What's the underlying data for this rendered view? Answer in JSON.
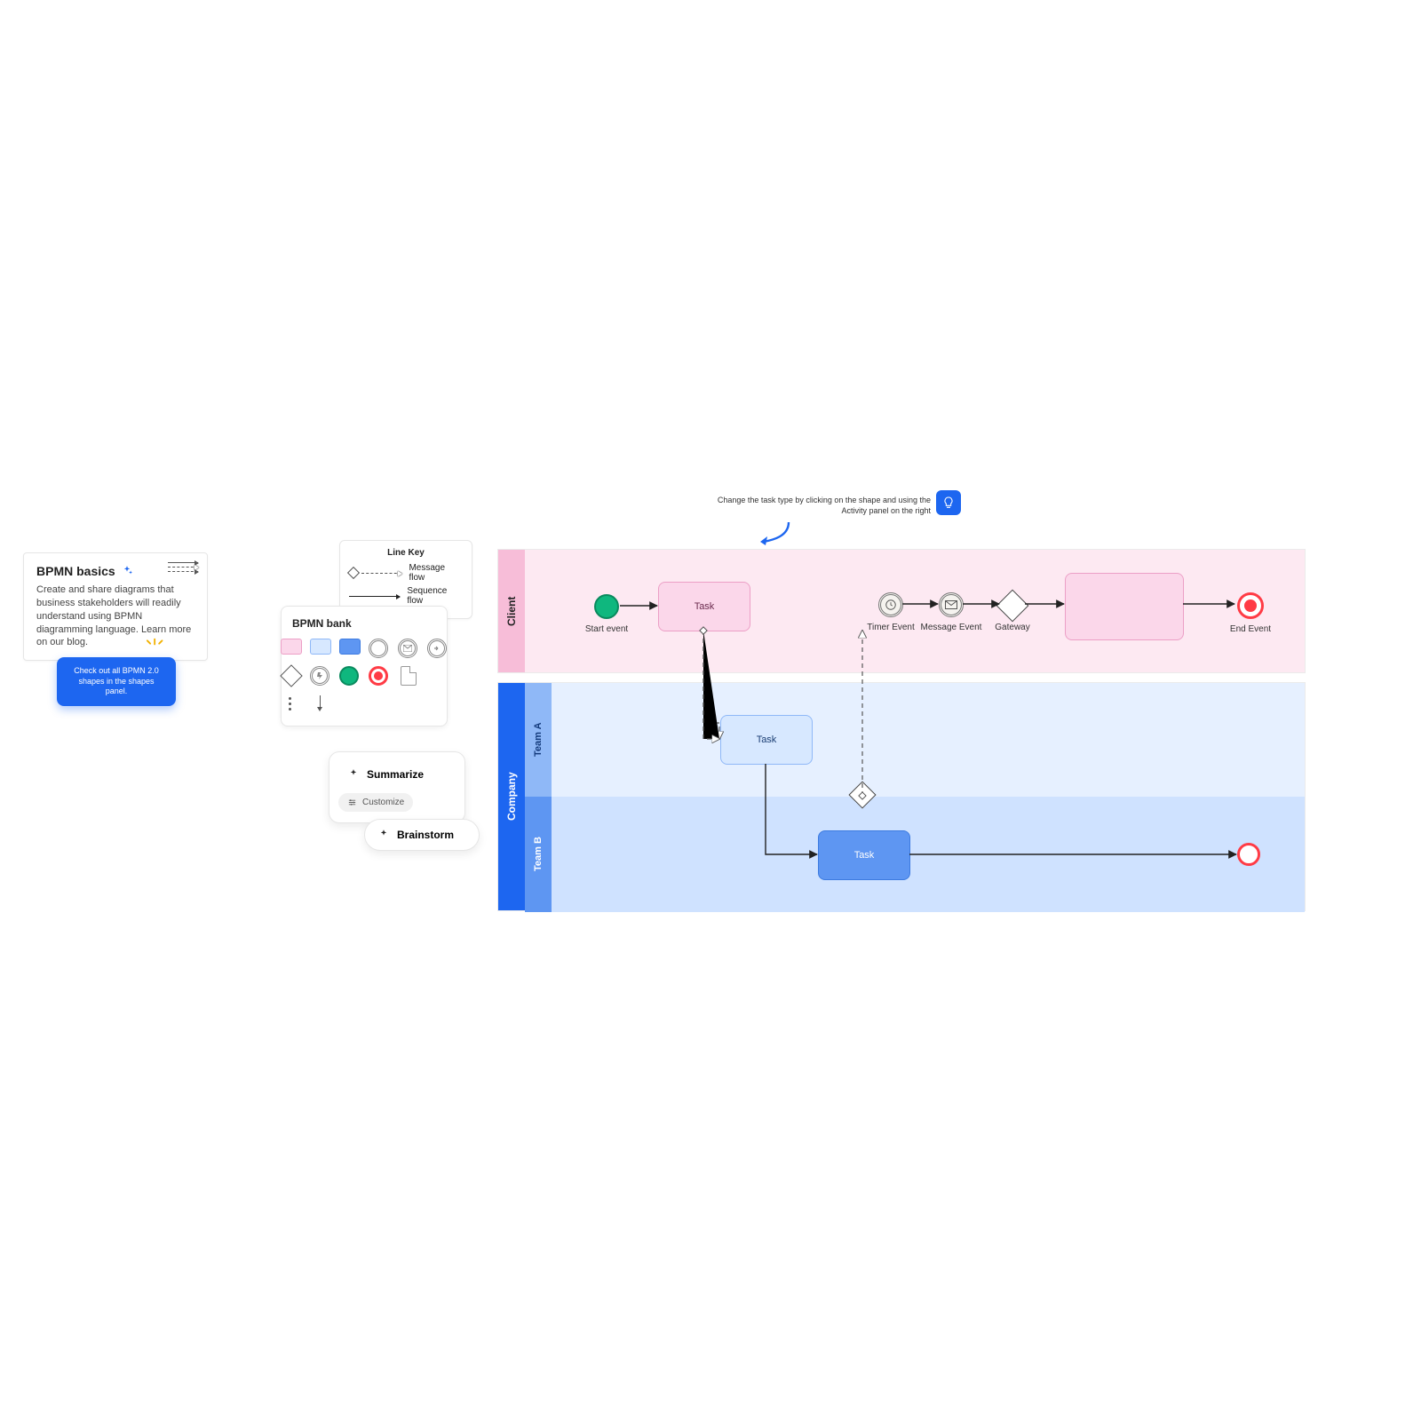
{
  "info": {
    "title": "BPMN basics",
    "desc": "Create and share diagrams that business stakeholders will readily understand using BPMN diagramming language. Learn more on our blog."
  },
  "cta": {
    "text": "Check out all BPMN 2.0 shapes in the shapes panel."
  },
  "linekey": {
    "title": "Line Key",
    "message_flow": "Message flow",
    "sequence_flow": "Sequence flow"
  },
  "bank": {
    "title": "BPMN bank",
    "colors": {
      "pink": "#fbd7ea",
      "lightblue": "#d7e8ff",
      "blue": "#5e96f2"
    }
  },
  "chips": {
    "summarize": "Summarize",
    "customize": "Customize",
    "brainstorm": "Brainstorm"
  },
  "tip": {
    "text": "Change the task type by clicking on the shape and using the Activity panel on the right"
  },
  "pools": {
    "client": {
      "label": "Client"
    },
    "company": {
      "label": "Company",
      "lanes": {
        "a": "Team A",
        "b": "Team B"
      }
    }
  },
  "nodes": {
    "start": "Start event",
    "task_client": "Task",
    "timer": "Timer Event",
    "message": "Message Event",
    "gateway": "Gateway",
    "task_client2_placeholder": "",
    "end": "End Event",
    "task_a": "Task",
    "task_b": "Task"
  }
}
